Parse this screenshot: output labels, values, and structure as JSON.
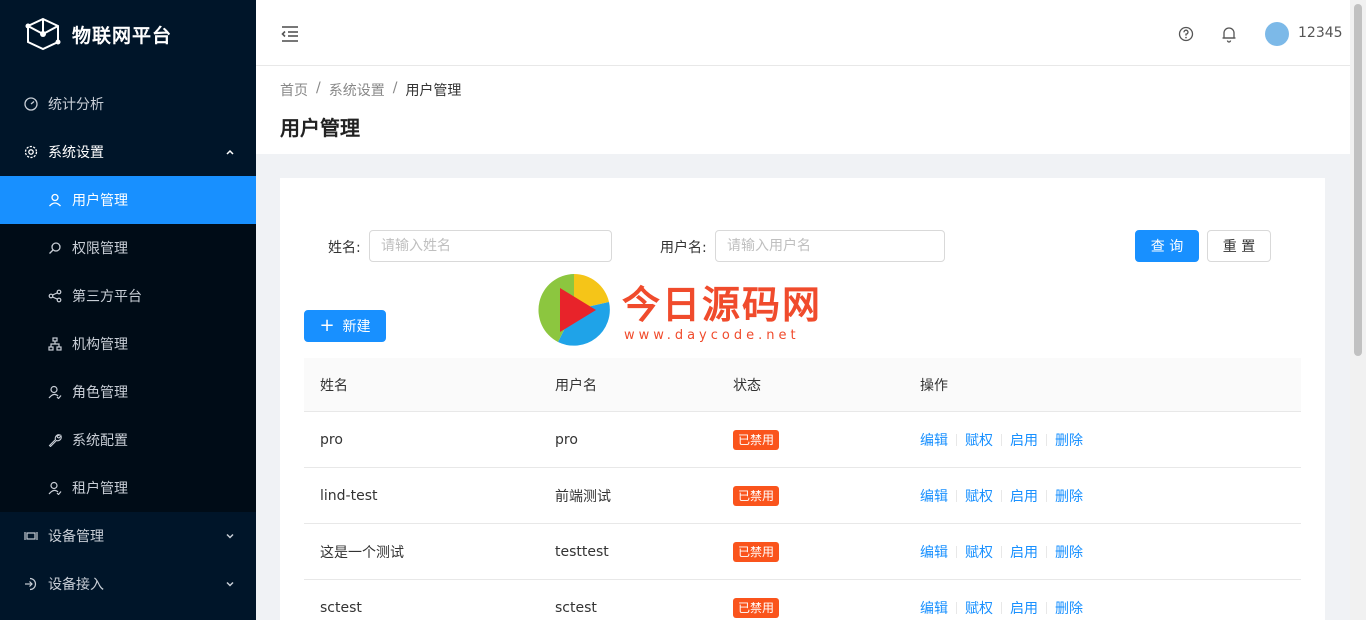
{
  "app": {
    "title": "物联网平台"
  },
  "sidebar": {
    "items": [
      {
        "label": "统计分析",
        "icon": "dashboard-icon"
      },
      {
        "label": "系统设置",
        "icon": "gear-icon",
        "open": true
      },
      {
        "label": "设备管理",
        "icon": "device-icon"
      },
      {
        "label": "设备接入",
        "icon": "login-icon"
      }
    ],
    "sub_items": [
      {
        "label": "用户管理",
        "icon": "user-icon",
        "active": true
      },
      {
        "label": "权限管理",
        "icon": "search-icon"
      },
      {
        "label": "第三方平台",
        "icon": "share-icon"
      },
      {
        "label": "机构管理",
        "icon": "org-icon"
      },
      {
        "label": "角色管理",
        "icon": "role-icon"
      },
      {
        "label": "系统配置",
        "icon": "wrench-icon"
      },
      {
        "label": "租户管理",
        "icon": "tenant-icon"
      }
    ]
  },
  "header": {
    "username": "12345"
  },
  "breadcrumb": [
    "首页",
    "系统设置",
    "用户管理"
  ],
  "page": {
    "title": "用户管理"
  },
  "search": {
    "name_label": "姓名:",
    "name_placeholder": "请输入姓名",
    "username_label": "用户名:",
    "username_placeholder": "请输入用户名",
    "query_button": "查 询",
    "reset_button": "重 置"
  },
  "new_button": "新建",
  "watermark": {
    "title": "今日源码网",
    "url": "www.daycode.net"
  },
  "table": {
    "columns": [
      "姓名",
      "用户名",
      "状态",
      "操作"
    ],
    "rows": [
      {
        "name": "pro",
        "username": "pro",
        "status": "已禁用"
      },
      {
        "name": "lind-test",
        "username": "前端测试",
        "status": "已禁用"
      },
      {
        "name": "这是一个测试",
        "username": "testtest",
        "status": "已禁用"
      },
      {
        "name": "sctest",
        "username": "sctest",
        "status": "已禁用"
      }
    ],
    "actions": [
      "编辑",
      "赋权",
      "启用",
      "删除"
    ]
  },
  "colors": {
    "primary": "#1890ff",
    "sidebar_bg": "#001529",
    "tag_disabled": "#fa541c",
    "watermark": "#f04b2c"
  }
}
